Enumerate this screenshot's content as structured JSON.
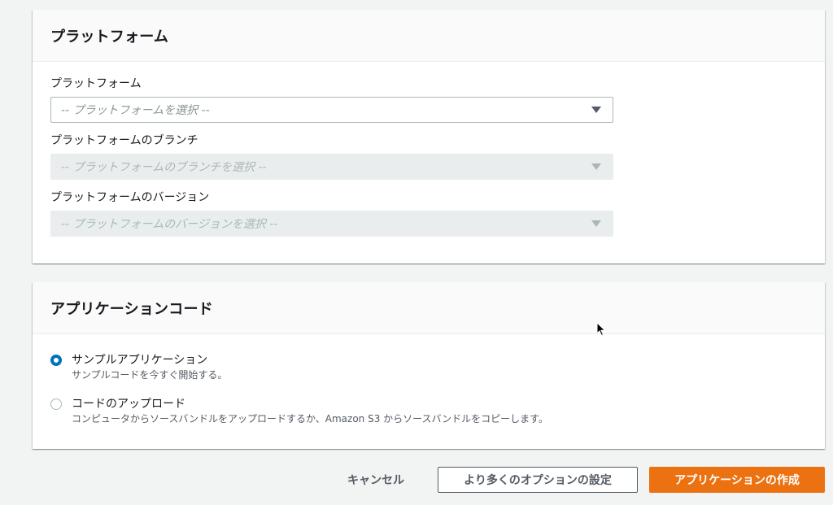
{
  "platform_panel": {
    "title": "プラットフォーム",
    "platform": {
      "label": "プラットフォーム",
      "placeholder": "-- プラットフォームを選択 --"
    },
    "branch": {
      "label": "プラットフォームのブランチ",
      "placeholder": "-- プラットフォームのブランチを選択 --"
    },
    "version": {
      "label": "プラットフォームのバージョン",
      "placeholder": "-- プラットフォームのバージョンを選択 --"
    }
  },
  "code_panel": {
    "title": "アプリケーションコード",
    "options": [
      {
        "title": "サンプルアプリケーション",
        "description": "サンプルコードを今すぐ開始する。",
        "selected": true
      },
      {
        "title": "コードのアップロード",
        "description": "コンピュータからソースバンドルをアップロードするか、Amazon S3 からソースバンドルをコピーします。",
        "selected": false
      }
    ]
  },
  "actions": {
    "cancel": "キャンセル",
    "more_options": "より多くのオプションの設定",
    "create": "アプリケーションの作成"
  },
  "colors": {
    "accent": "#ec7211",
    "radio_selected": "#0073bb",
    "page_background": "#f2f3f3"
  }
}
